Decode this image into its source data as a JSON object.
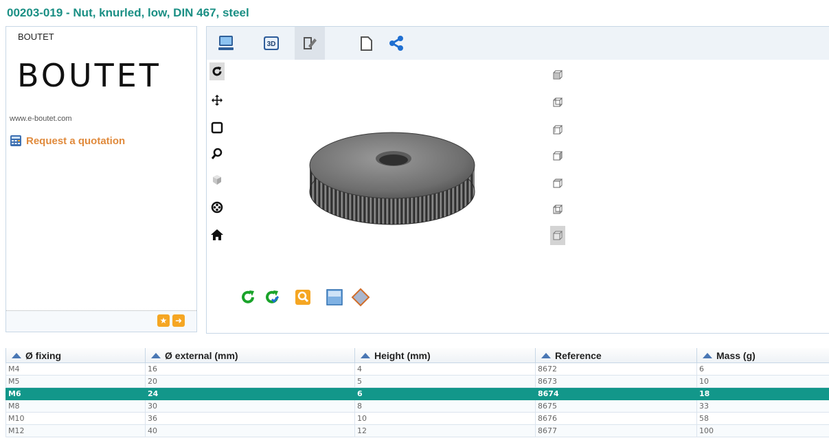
{
  "page": {
    "title": "00203-019 - Nut, knurled, low, DIN 467, steel"
  },
  "supplier": {
    "header": "BOUTET",
    "logo_text": "BOUTET",
    "website": "www.e-boutet.com",
    "quote_label": "Request a quotation"
  },
  "viewer": {
    "toolbar": [
      {
        "icon": "monitor-icon",
        "active": false
      },
      {
        "icon": "3d-icon",
        "label": "3D",
        "active": false
      },
      {
        "icon": "edit-document-icon",
        "active": true
      },
      {
        "icon": "blank-page-icon",
        "active": false
      },
      {
        "icon": "share-icon",
        "active": false
      }
    ],
    "left_tools": [
      "rotate-icon",
      "pan-icon",
      "frame-icon",
      "zoom-icon",
      "cube-icon",
      "film-reel-icon",
      "home-icon"
    ],
    "selected_left_tool": "rotate-icon",
    "view_cubes": 7,
    "selected_view_cube": 6
  },
  "table": {
    "columns": [
      "Ø fixing",
      "Ø external (mm)",
      "Height (mm)",
      "Reference",
      "Mass (g)"
    ],
    "rows": [
      [
        "M4",
        "16",
        "4",
        "8672",
        "6"
      ],
      [
        "M5",
        "20",
        "5",
        "8673",
        "10"
      ],
      [
        "M6",
        "24",
        "6",
        "8674",
        "18"
      ],
      [
        "M8",
        "30",
        "8",
        "8675",
        "33"
      ],
      [
        "M10",
        "36",
        "10",
        "8676",
        "58"
      ],
      [
        "M12",
        "40",
        "12",
        "8677",
        "100"
      ]
    ],
    "selected_row": 2
  },
  "colors": {
    "title": "#1a8f84",
    "selected_row": "#12978a",
    "accent_orange": "#e08a3c"
  }
}
